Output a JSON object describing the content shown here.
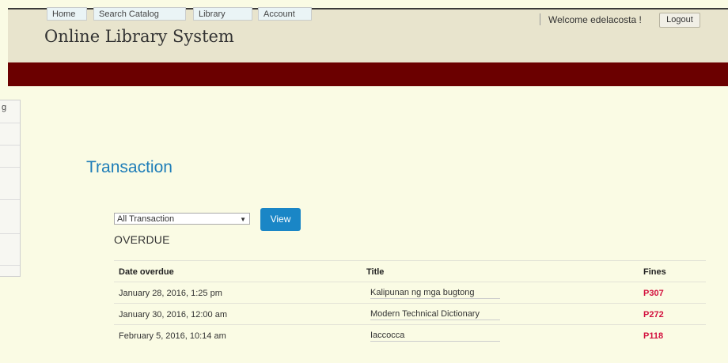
{
  "header": {
    "site_title": "Online Library System",
    "welcome": "Welcome edelacosta !",
    "logout_label": "Logout"
  },
  "nav": {
    "items": [
      {
        "label": "Home"
      },
      {
        "label": "Search Catalog"
      },
      {
        "label": "Library"
      },
      {
        "label": "Account"
      }
    ]
  },
  "left_panel": {
    "text": "g"
  },
  "main": {
    "page_title": "Transaction",
    "filter": {
      "selected": "All Transaction"
    },
    "view_label": "View",
    "section_title": "OVERDUE",
    "table": {
      "headers": [
        "Date overdue",
        "Title",
        "Fines"
      ],
      "rows": [
        {
          "date": "January 28, 2016, 1:25 pm",
          "title": "Kalipunan ng mga bugtong",
          "fine": "P307"
        },
        {
          "date": "January 30, 2016, 12:00 am",
          "title": "Modern Technical Dictionary",
          "fine": "P272"
        },
        {
          "date": "February 5, 2016, 10:14 am",
          "title": "Iaccocca",
          "fine": "P118"
        }
      ]
    }
  },
  "colors": {
    "nav_bg": "#6b0000",
    "accent": "#1e7db8",
    "fine": "#d3103e"
  }
}
